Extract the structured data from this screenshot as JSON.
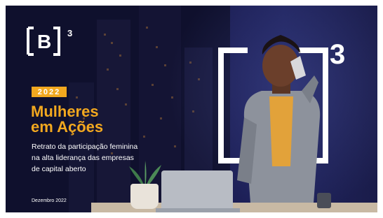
{
  "cover": {
    "logo_letter": "[B]",
    "logo_sup": "3",
    "year": "2022",
    "title_line1": "Mulheres",
    "title_line2": "em Ações",
    "subtitle_line1": "Retrato da participação feminina",
    "subtitle_line2": "na alta liderança das empresas",
    "subtitle_line3": "de capital aberto",
    "date": "Dezembro 2022",
    "bracket_sup": "3"
  },
  "colors": {
    "accent": "#f2a81f",
    "background": "#15163d",
    "text": "#ffffff"
  }
}
